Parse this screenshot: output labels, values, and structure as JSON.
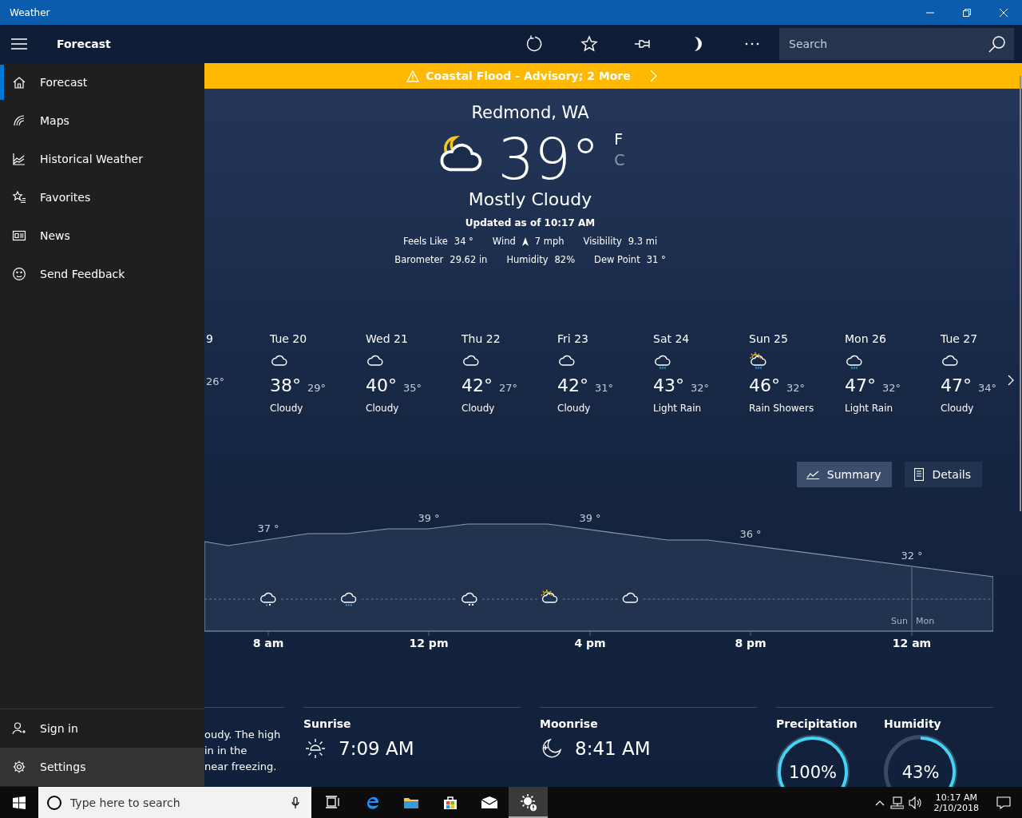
{
  "window": {
    "title": "Weather"
  },
  "app_bar": {
    "title": "Forecast",
    "search": {
      "placeholder": "Search"
    }
  },
  "nav": {
    "items": [
      {
        "label": "Forecast",
        "kind": "home",
        "selected": true
      },
      {
        "label": "Maps",
        "kind": "maps",
        "selected": false
      },
      {
        "label": "Historical Weather",
        "kind": "history",
        "selected": false
      },
      {
        "label": "Favorites",
        "kind": "favorites",
        "selected": false
      },
      {
        "label": "News",
        "kind": "news",
        "selected": false
      },
      {
        "label": "Send Feedback",
        "kind": "feedback",
        "selected": false
      }
    ],
    "bottom_items": [
      {
        "label": "Sign in",
        "kind": "person",
        "hovered": false
      },
      {
        "label": "Settings",
        "kind": "gear",
        "hovered": true
      }
    ]
  },
  "alert": {
    "text": "Coastal Flood - Advisory; 2 More"
  },
  "current": {
    "location": "Redmond, WA",
    "kind": "night-cloudy",
    "temperature": "39°",
    "units": [
      {
        "label": "F",
        "selected": true
      },
      {
        "label": "C",
        "selected": false
      }
    ],
    "condition": "Mostly Cloudy",
    "updated": "Updated as of 10:17 AM",
    "details": [
      [
        {
          "label": "Feels Like",
          "value": "34 °"
        },
        {
          "label": "Wind",
          "value": "7 mph",
          "kind": "wind"
        },
        {
          "label": "Visibility",
          "value": "9.3 mi"
        }
      ],
      [
        {
          "label": "Barometer",
          "value": "29.62 in"
        },
        {
          "label": "Humidity",
          "value": "82%"
        },
        {
          "label": "Dew Point",
          "value": "31 °"
        }
      ]
    ]
  },
  "daily": [
    {
      "day": "9",
      "low": "26°"
    },
    {
      "day": "Tue 20",
      "kind": "cloudy",
      "high": "38°",
      "low": "29°",
      "condition": "Cloudy"
    },
    {
      "day": "Wed 21",
      "kind": "cloudy",
      "high": "40°",
      "low": "35°",
      "condition": "Cloudy"
    },
    {
      "day": "Thu 22",
      "kind": "cloudy",
      "high": "42°",
      "low": "27°",
      "condition": "Cloudy"
    },
    {
      "day": "Fri 23",
      "kind": "cloudy",
      "high": "42°",
      "low": "31°",
      "condition": "Cloudy"
    },
    {
      "day": "Sat 24",
      "kind": "rain",
      "high": "43°",
      "low": "32°",
      "condition": "Light Rain"
    },
    {
      "day": "Sun 25",
      "kind": "sun-rain",
      "high": "46°",
      "low": "32°",
      "condition": "Rain Showers"
    },
    {
      "day": "Mon 26",
      "kind": "rain",
      "high": "47°",
      "low": "32°",
      "condition": "Light Rain"
    },
    {
      "day": "Tue 27",
      "kind": "cloudy",
      "high": "47°",
      "low": "34°",
      "condition": "Cloudy"
    }
  ],
  "view_toggle": [
    {
      "label": "Summary",
      "kind": "chart",
      "selected": true
    },
    {
      "label": "Details",
      "kind": "list",
      "selected": false
    }
  ],
  "hourly": {
    "temperature_labels": [
      "37 °",
      "39 °",
      "39 °",
      "36 °",
      "32 °"
    ],
    "time_labels": [
      "8 am",
      "12 pm",
      "4 pm",
      "8 pm",
      "12 am"
    ],
    "icons": [
      {
        "kind": "snow-rain"
      },
      {
        "kind": "rain"
      },
      {
        "kind": "snow"
      },
      {
        "kind": "sun-cloud"
      },
      {
        "kind": "cloudy"
      }
    ],
    "day_change": {
      "before": "Sun",
      "after": "Mon"
    }
  },
  "cards": {
    "summary_lines": [
      "oudy. The high",
      "in in the",
      "near freezing."
    ],
    "sun": {
      "label": "Sunrise",
      "value": "7:09 AM",
      "kind": "sunrise"
    },
    "moon": {
      "label": "Moonrise",
      "value": "8:41 AM",
      "kind": "moonrise"
    },
    "gauges": [
      {
        "label": "Precipitation",
        "value": "100%",
        "level": 1
      },
      {
        "label": "Humidity",
        "value": "43%",
        "level": 0.43
      }
    ]
  },
  "taskbar": {
    "search": {
      "placeholder": "Type here to search"
    },
    "apps": [
      {
        "kind": "task-view",
        "selected": false
      },
      {
        "kind": "edge",
        "selected": false
      },
      {
        "kind": "folder",
        "selected": false
      },
      {
        "kind": "store",
        "selected": false
      },
      {
        "kind": "mail",
        "selected": false
      },
      {
        "kind": "weather",
        "selected": true
      }
    ],
    "time": "10:17 AM",
    "date": "2/10/2018"
  }
}
